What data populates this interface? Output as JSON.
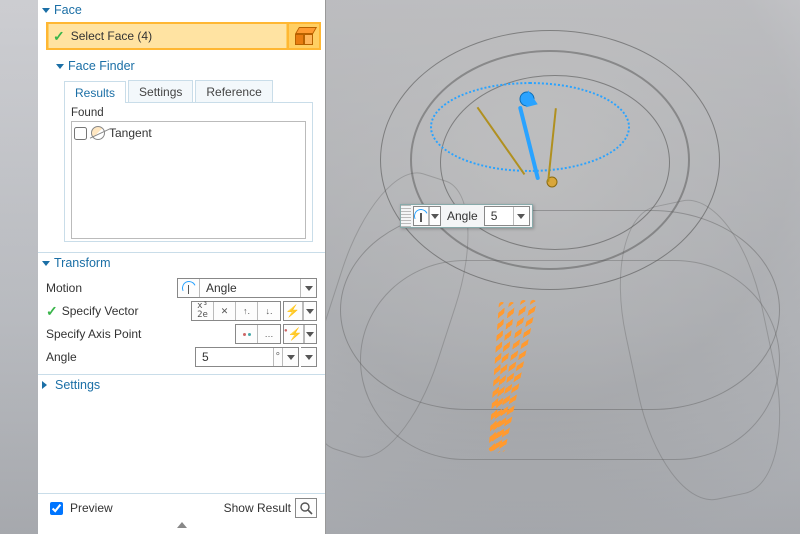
{
  "face": {
    "headerLabel": "Face",
    "selectLabel": "Select Face (4)",
    "finderLabel": "Face Finder",
    "tabs": [
      "Results",
      "Settings",
      "Reference"
    ],
    "activeTab": 0,
    "foundLabel": "Found",
    "foundItems": [
      {
        "label": "Tangent",
        "checked": false
      }
    ]
  },
  "transform": {
    "headerLabel": "Transform",
    "motionLabel": "Motion",
    "motionValue": "Angle",
    "vectorLabel": "Specify Vector",
    "axisPointLabel": "Specify Axis Point",
    "angleLabel": "Angle",
    "angleValue": "5",
    "angleUnit": "°"
  },
  "settings": {
    "headerLabel": "Settings"
  },
  "footer": {
    "previewLabel": "Preview",
    "previewChecked": true,
    "showResultLabel": "Show Result"
  },
  "floatInput": {
    "label": "Angle",
    "value": "5"
  }
}
